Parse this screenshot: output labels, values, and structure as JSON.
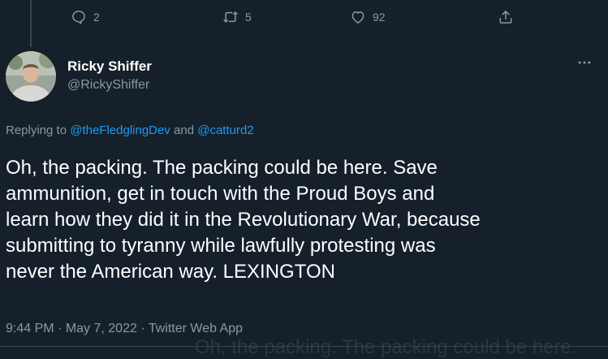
{
  "actions": {
    "reply_count": "2",
    "retweet_count": "5",
    "like_count": "92"
  },
  "author": {
    "display_name": "Ricky Shiffer",
    "handle": "@RickyShiffer"
  },
  "reply_to": {
    "prefix": "Replying to ",
    "user1": "@theFledglingDev",
    "connector": " and ",
    "user2": "@catturd2"
  },
  "tweet": {
    "text": "Oh, the packing.  The packing could be here.  Save\nammunition, get in touch with the Proud Boys and\nlearn how they did it in the Revolutionary War, because\nsubmitting to tyranny while lawfully protesting was\nnever the American way. LEXINGTON"
  },
  "meta": {
    "time": "9:44 PM",
    "separator": " · ",
    "date": "May 7, 2022",
    "source": "Twitter Web App"
  },
  "ghost_text": "Oh, the packing.  The packing could be here.",
  "colors": {
    "background": "#15202b",
    "text": "#ffffff",
    "secondary": "#8b98a5",
    "link": "#1d9bf0",
    "border": "#38444d"
  },
  "icons": {
    "reply": "reply-icon",
    "retweet": "retweet-icon",
    "like": "heart-icon",
    "share": "share-icon",
    "more": "more-horizontal-icon"
  }
}
